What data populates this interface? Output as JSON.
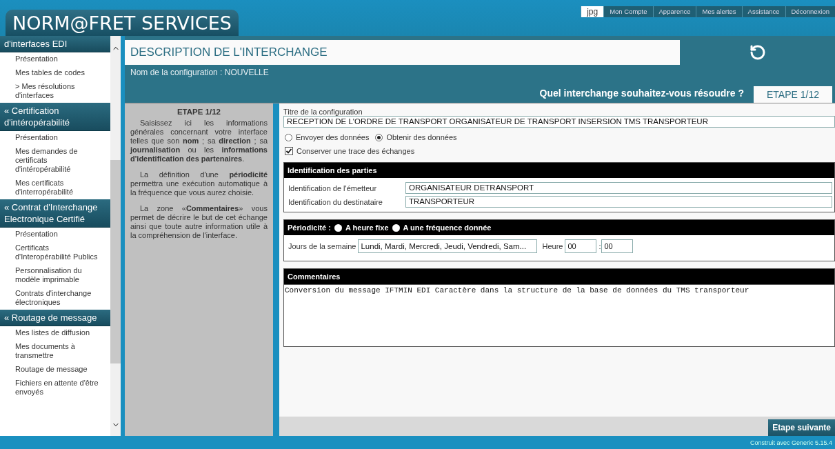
{
  "header": {
    "logo": "NORM@FRET SERVICES",
    "tabs": [
      {
        "label": "jpg",
        "selected": true
      },
      {
        "label": "Mon Compte",
        "selected": false
      },
      {
        "label": "Apparence",
        "selected": false
      },
      {
        "label": "Mes alertes",
        "selected": false
      },
      {
        "label": "Assistance",
        "selected": false
      },
      {
        "label": "Déconnexion",
        "selected": false
      }
    ]
  },
  "sidebar": {
    "sections": [
      {
        "title": "d'interfaces EDI",
        "items": [
          "Présentation",
          "Mes tables de codes",
          "> Mes résolutions d'interfaces"
        ]
      },
      {
        "marker": "«",
        "title": "Certification d'intéropérabilité",
        "items": [
          "Présentation",
          "Mes demandes de certificats d'intéropérabilité",
          "Mes certificats d'interropérabilité"
        ]
      },
      {
        "marker": "«",
        "title": "Contrat d'Interchange Electronique Certifié",
        "items": [
          "Présentation",
          "Certificats d'Interopérabilité Publics",
          "Personnalisation du modèle imprimable",
          "Contrats d'interchange électroniques"
        ]
      },
      {
        "marker": "«",
        "title": "Routage de message",
        "items": [
          "Mes listes de diffusion",
          "Mes documents à transmettre",
          "Routage de message",
          "Fichiers en attente d'être envoyés"
        ]
      }
    ]
  },
  "page": {
    "title": "DESCRIPTION DE L'INTERCHANGE",
    "config_name": "Nom de la configuration : NOUVELLE",
    "question": "Quel interchange souhaitez-vous résoudre ?",
    "step_tab": "ETAPE 1/12"
  },
  "help": {
    "heading": "ETAPE 1/12",
    "paragraphs": [
      "Saisissez ici les informations générales concernant votre interface telles que son **nom** ; sa **direction** ; sa **journalisation** ou les **informations d'identification des partenaires**.",
      "La définition d'une **périodicité** permettra une exécution automatique à la fréquence que vous aurez choisie.",
      "La zone «**Commentaires**» vous permet de décrire le but de cet échange ainsi que toute autre information utile à la compréhension de l'interface."
    ]
  },
  "form": {
    "title_label": "Titre de la configuration",
    "title_value": "RECEPTION DE L'ORDRE DE TRANSPORT ORGANISATEUR DE TRANSPORT INSERSION TMS TRANSPORTEUR",
    "direction": [
      {
        "label": "Envoyer des données",
        "selected": false
      },
      {
        "label": "Obtenir des données",
        "selected": true
      }
    ],
    "trace": {
      "label": "Conserver une trace des échanges",
      "checked": true
    },
    "parties": {
      "heading": "Identification des parties",
      "fields": [
        {
          "label": "Identification de l'émetteur",
          "value": "ORGANISATEUR DETRANSPORT"
        },
        {
          "label": "Identification du destinataire",
          "value": "TRANSPORTEUR"
        }
      ]
    },
    "periodicity": {
      "heading": "Périodicité :",
      "options": [
        {
          "label": "A heure fixe",
          "selected": false
        },
        {
          "label": "A une fréquence donnée",
          "selected": false
        }
      ],
      "days_label": "Jours de la semaine",
      "days_value": "Lundi, Mardi, Mercredi, Jeudi, Vendredi, Sam...",
      "hour_label": "Heure",
      "hour": "00",
      "minute_sep": ":",
      "minute": "00"
    },
    "comments": {
      "heading": "Commentaires",
      "value": "Conversion du message IFTMIN EDI Caractère dans la structure de la base de données du TMS transporteur"
    }
  },
  "next_button": "Etape suivante",
  "footer": "Construit avec Generic 5.15.4"
}
